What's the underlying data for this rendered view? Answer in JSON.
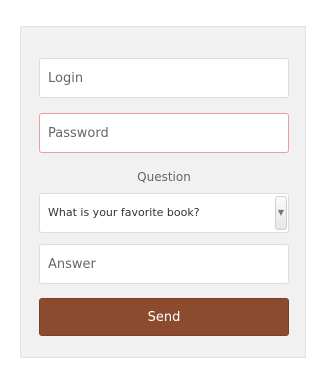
{
  "form": {
    "login_placeholder": "Login",
    "password_placeholder": "Password",
    "question_label": "Question",
    "question_selected": "What is your favorite book?",
    "answer_placeholder": "Answer",
    "send_label": "Send"
  },
  "icons": {
    "select_arrow": "chevron-down-icon"
  },
  "colors": {
    "send_button": "#8b4b2f",
    "password_border": "#e9a0a0",
    "card_background": "#f1f1f1"
  }
}
